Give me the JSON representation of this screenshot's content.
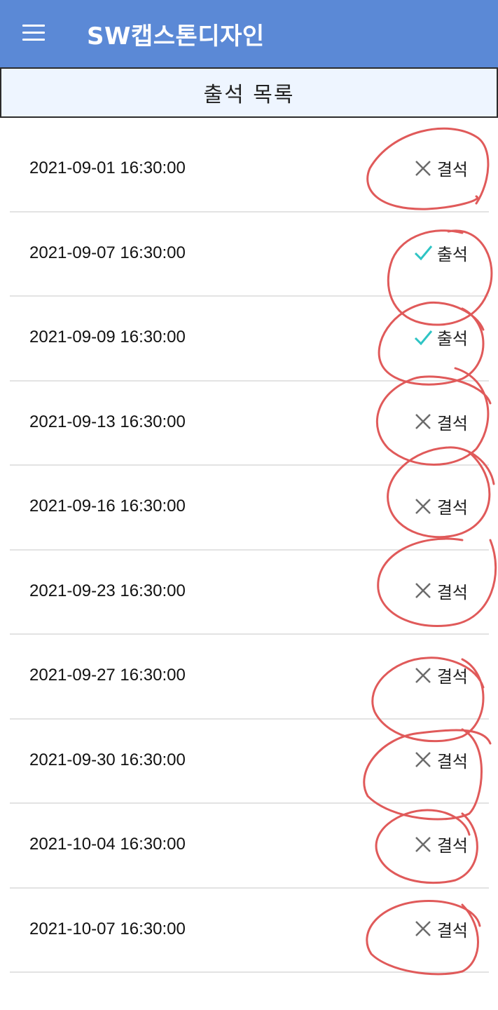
{
  "app": {
    "title": "SW캡스톤디자인",
    "menu_icon": "hamburger-menu-icon",
    "bar_color": "#5b89d6"
  },
  "header": {
    "title": "출석 목록"
  },
  "attendance": [
    {
      "datetime": "2021-09-01 16:30:00",
      "status": "결석",
      "icon": "close-x-icon"
    },
    {
      "datetime": "2021-09-07 16:30:00",
      "status": "출석",
      "icon": "check-icon"
    },
    {
      "datetime": "2021-09-09 16:30:00",
      "status": "출석",
      "icon": "check-icon"
    },
    {
      "datetime": "2021-09-13 16:30:00",
      "status": "결석",
      "icon": "close-x-icon"
    },
    {
      "datetime": "2021-09-16 16:30:00",
      "status": "결석",
      "icon": "close-x-icon"
    },
    {
      "datetime": "2021-09-23 16:30:00",
      "status": "결석",
      "icon": "close-x-icon"
    },
    {
      "datetime": "2021-09-27 16:30:00",
      "status": "결석",
      "icon": "close-x-icon"
    },
    {
      "datetime": "2021-09-30 16:30:00",
      "status": "결석",
      "icon": "close-x-icon"
    },
    {
      "datetime": "2021-10-04 16:30:00",
      "status": "결석",
      "icon": "close-x-icon"
    },
    {
      "datetime": "2021-10-07 16:30:00",
      "status": "결석",
      "icon": "close-x-icon"
    }
  ],
  "colors": {
    "check": "#2ec4c4",
    "cross": "#6b6b6b",
    "annotation": "#e05a5a"
  }
}
